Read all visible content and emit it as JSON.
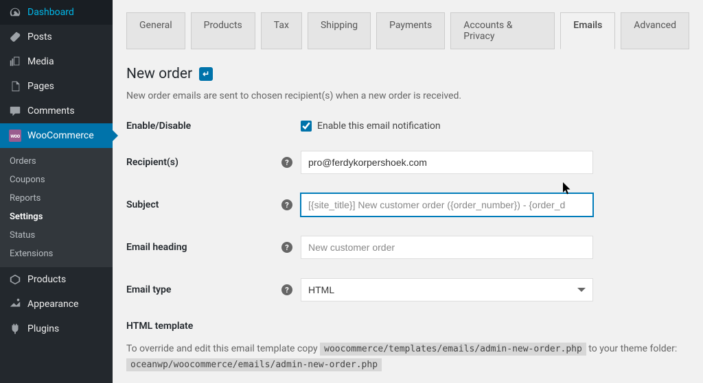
{
  "sidebar": {
    "items": [
      {
        "label": "Dashboard",
        "icon": "dashboard"
      },
      {
        "label": "Posts",
        "icon": "pin"
      },
      {
        "label": "Media",
        "icon": "media"
      },
      {
        "label": "Pages",
        "icon": "pages"
      },
      {
        "label": "Comments",
        "icon": "comments"
      },
      {
        "label": "WooCommerce",
        "icon": "woo"
      },
      {
        "label": "Products",
        "icon": "products"
      },
      {
        "label": "Appearance",
        "icon": "appearance"
      },
      {
        "label": "Plugins",
        "icon": "plugins"
      }
    ],
    "submenu": [
      {
        "label": "Orders"
      },
      {
        "label": "Coupons"
      },
      {
        "label": "Reports"
      },
      {
        "label": "Settings"
      },
      {
        "label": "Status"
      },
      {
        "label": "Extensions"
      }
    ]
  },
  "tabs": [
    {
      "label": "General"
    },
    {
      "label": "Products"
    },
    {
      "label": "Tax"
    },
    {
      "label": "Shipping"
    },
    {
      "label": "Payments"
    },
    {
      "label": "Accounts & Privacy"
    },
    {
      "label": "Emails"
    },
    {
      "label": "Advanced"
    }
  ],
  "page": {
    "title": "New order",
    "description": "New order emails are sent to chosen recipient(s) when a new order is received."
  },
  "form": {
    "enable_label": "Enable/Disable",
    "enable_checkbox_label": "Enable this email notification",
    "recipient_label": "Recipient(s)",
    "recipient_value": "pro@ferdykorpershoek.com",
    "subject_label": "Subject",
    "subject_placeholder": "[{site_title}] New customer order ({order_number}) - {order_d",
    "heading_label": "Email heading",
    "heading_placeholder": "New customer order",
    "email_type_label": "Email type",
    "email_type_value": "HTML"
  },
  "template": {
    "title": "HTML template",
    "text_before": "To override and edit this email template copy ",
    "path1": "woocommerce/templates/emails/admin-new-order.php",
    "text_middle": " to your theme folder: ",
    "path2": "oceanwp/woocommerce/emails/admin-new-order.php"
  }
}
